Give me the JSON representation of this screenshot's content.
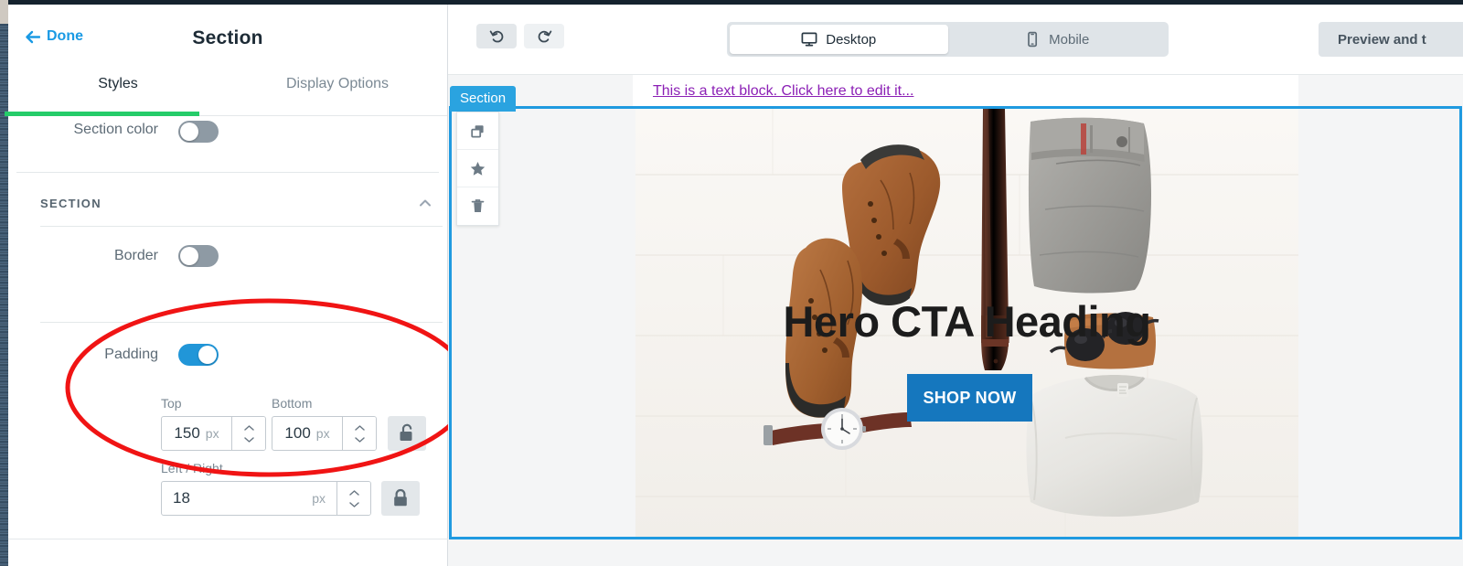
{
  "sidebar": {
    "done_label": "Done",
    "title": "Section",
    "tabs": [
      {
        "label": "Styles",
        "active": true
      },
      {
        "label": "Display Options",
        "active": false
      }
    ],
    "section_color": {
      "label": "Section color",
      "state": "off"
    },
    "group": {
      "title": "SECTION",
      "collapse_icon": "chevron-up-icon"
    },
    "border": {
      "label": "Border",
      "state": "off"
    },
    "padding": {
      "label": "Padding",
      "state": "on",
      "top": {
        "label": "Top",
        "value": "150",
        "unit": "px"
      },
      "bottom": {
        "label": "Bottom",
        "value": "100",
        "unit": "px"
      },
      "left_right": {
        "label": "Left / Right",
        "value": "18",
        "unit": "px"
      },
      "lock_top_bottom": "unlocked",
      "lock_left_right": "locked"
    }
  },
  "toolbar": {
    "undo_icon": "undo-icon",
    "redo_icon": "redo-icon",
    "devices": [
      {
        "label": "Desktop",
        "icon": "monitor-icon",
        "active": true
      },
      {
        "label": "Mobile",
        "icon": "phone-icon",
        "active": false
      }
    ],
    "preview_label": "Preview and t"
  },
  "canvas": {
    "text_block_link": "This is a text block. Click here to edit it...",
    "section_tab_label": "Section",
    "float_actions": [
      {
        "icon": "duplicate-icon",
        "name": "duplicate"
      },
      {
        "icon": "star-icon",
        "name": "favorite"
      },
      {
        "icon": "trash-icon",
        "name": "delete"
      }
    ],
    "hero": {
      "heading": "Hero CTA Heading",
      "cta_label": "SHOP NOW"
    }
  },
  "colors": {
    "accent_blue": "#1f9ae0",
    "link_blue": "#1a9ae4",
    "active_tab_green": "#25cc69",
    "toggle_on": "#2196d8",
    "toggle_off": "#8e9aa4",
    "cta_blue": "#1577be",
    "link_purple": "#8b1fb5",
    "annotation_red": "#f01414"
  }
}
